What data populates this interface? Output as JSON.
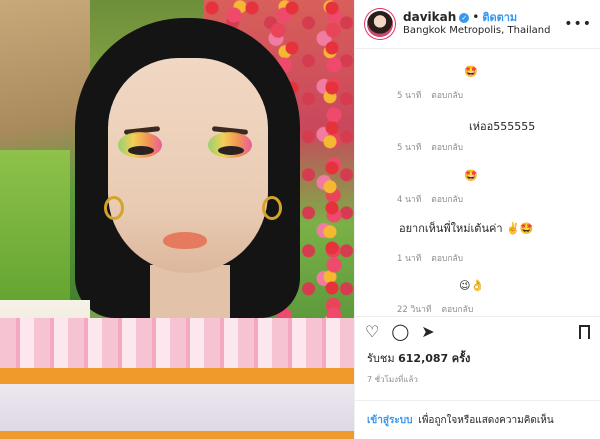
{
  "header": {
    "handle": "davikah",
    "verified": "✓",
    "separator": "•",
    "follow_label": "ติดตาม",
    "location": "Bangkok Metropolis, Thailand",
    "more": "•••"
  },
  "comments": [
    {
      "username": "",
      "text": "🤩",
      "time": "5 นาที",
      "reply": "ตอบกลับ"
    },
    {
      "username": "",
      "text": "เห่ออ555555",
      "time": "5 นาที",
      "reply": "ตอบกลับ"
    },
    {
      "username": "",
      "text": "🤩",
      "time": "4 นาที",
      "reply": "ตอบกลับ"
    },
    {
      "username": "",
      "text": "อยากเห็นพี่ใหม่เต้นค่า ✌️🤩",
      "time": "1 นาที",
      "reply": "ตอบกลับ"
    },
    {
      "username": "",
      "text": "😉👌",
      "time": "22 วินาที",
      "reply": "ตอบกลับ"
    }
  ],
  "actions": {
    "like": "♡",
    "comment": "◯",
    "share": "➤"
  },
  "views": {
    "prefix": "รับชม",
    "count": "612,087",
    "suffix": "ครั้ง"
  },
  "timestamp": "7 ชั่วโมงที่แล้ว",
  "login": {
    "link": "เข้าสู่ระบบ",
    "rest": "เพื่อถูกใจหรือแสดงความคิดเห็น"
  },
  "colors": {
    "accent": "#3897f0",
    "text": "#262626",
    "muted": "#8e8e8e"
  }
}
